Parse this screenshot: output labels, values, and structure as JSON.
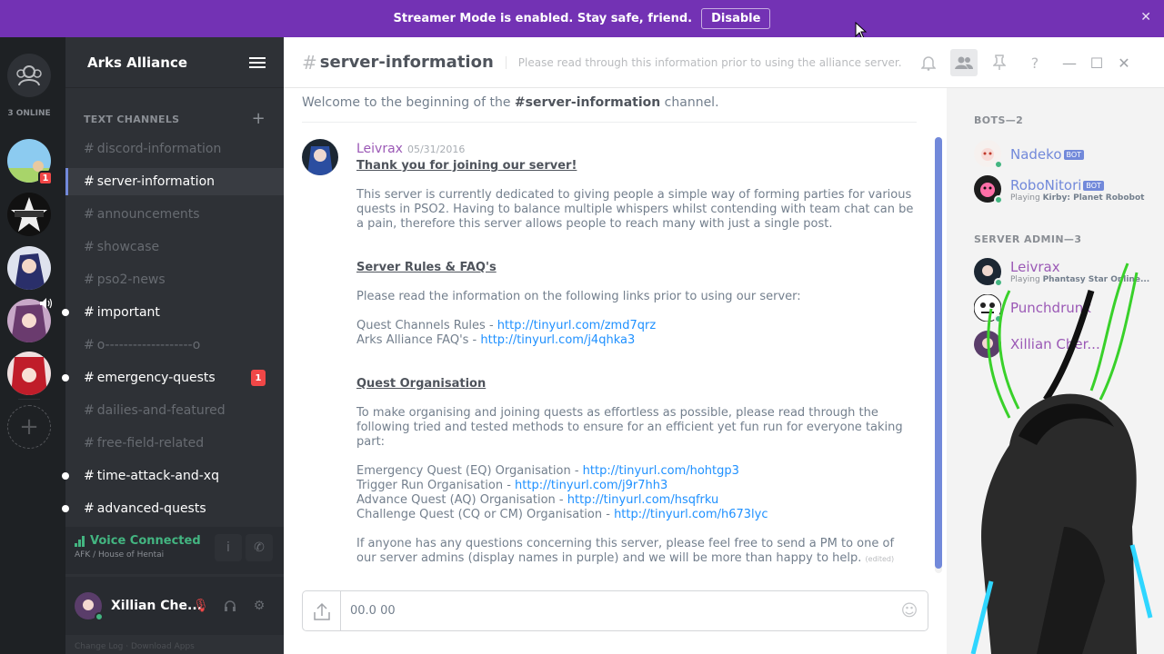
{
  "banner": {
    "text": "Streamer Mode is enabled. Stay safe, friend.",
    "button": "Disable",
    "close_glyph": "✕"
  },
  "guilds": {
    "online_text": "3 ONLINE",
    "badges": [
      "1"
    ]
  },
  "server": {
    "name": "Arks Alliance",
    "category": "TEXT CHANNELS",
    "channels": [
      {
        "name": "discord-information",
        "state": "read"
      },
      {
        "name": "server-information",
        "state": "active"
      },
      {
        "name": "announcements",
        "state": "read"
      },
      {
        "name": "showcase",
        "state": "read"
      },
      {
        "name": "pso2-news",
        "state": "read"
      },
      {
        "name": "important",
        "state": "unread"
      },
      {
        "name": "o-------------------o",
        "state": "read"
      },
      {
        "name": "emergency-quests",
        "state": "unread",
        "mentions": "1"
      },
      {
        "name": "dailies-and-featured",
        "state": "read"
      },
      {
        "name": "free-field-related",
        "state": "read"
      },
      {
        "name": "time-attack-and-xq",
        "state": "unread"
      },
      {
        "name": "advanced-quests",
        "state": "unread"
      }
    ]
  },
  "voice": {
    "status": "Voice Connected",
    "channel": "AFK / House of Hentai"
  },
  "user": {
    "name": "Xillian Che..."
  },
  "footer": {
    "links": "Change Log · Download Apps"
  },
  "chat": {
    "channel_name": "server-information",
    "topic": "Please read through this information prior to using the alliance server.",
    "welcome_prefix": "Welcome to the beginning of the ",
    "welcome_channel": "#server-information",
    "welcome_suffix": " channel.",
    "message": {
      "author": "Leivrax",
      "timestamp": "05/31/2016",
      "heading1": "Thank you for joining our server!",
      "para1": "This server is currently dedicated to giving people a simple way of forming parties for various quests in PSO2.  Having to balance multiple whispers whilst contending with team chat can be a pain, therefore this server allows people to reach many with just a single post.",
      "heading2": "Server Rules & FAQ's",
      "para2": "Please read the information on the following links prior to using our server:",
      "links1": [
        {
          "label": "Quest Channels Rules - ",
          "url": "http://tinyurl.com/zmd7qrz"
        },
        {
          "label": "Arks Alliance FAQ's - ",
          "url": "http://tinyurl.com/j4qhka3"
        }
      ],
      "heading3": "Quest Organisation",
      "para3": "To make organising and joining quests as effortless as possible, please read through the following tried and tested methods to ensure for an efficient yet fun run for everyone taking part:",
      "links2": [
        {
          "label": "Emergency Quest (EQ) Organisation - ",
          "url": "http://tinyurl.com/hohtgp3"
        },
        {
          "label": "Trigger Run Organisation - ",
          "url": "http://tinyurl.com/j9r7hh3"
        },
        {
          "label": "Advance Quest (AQ) Organisation - ",
          "url": "http://tinyurl.com/hsqfrku"
        },
        {
          "label": "Challenge Quest (CQ or CM) Organisation - ",
          "url": "http://tinyurl.com/h673lyc"
        }
      ],
      "para4": "If anyone has any questions concerning this server, please feel free to send a PM to one of our server admins (display names in purple) and we will be more than happy to help.",
      "edited": "(edited)"
    },
    "composer_value": "00.0 00"
  },
  "members": {
    "bots_header": "BOTS—2",
    "admin_header": "SERVER ADMIN—3",
    "bots": [
      {
        "name": "Nadeko",
        "tag": "BOT",
        "playing": ""
      },
      {
        "name": "RoboNitori",
        "tag": "BOT",
        "playing_prefix": "Playing ",
        "playing": "Kirby: Planet Robobot"
      }
    ],
    "admins": [
      {
        "name": "Leivrax",
        "playing_prefix": "Playing ",
        "playing": "Phantasy Star Online..."
      },
      {
        "name": "Punchdrunk",
        "playing": ""
      },
      {
        "name": "Xillian Cher...",
        "playing": ""
      }
    ]
  },
  "colors": {
    "banner": "#7332b4",
    "accent": "#7289da",
    "admin": "#9b59b6",
    "online": "#43b581",
    "link": "#1e90ff",
    "mention": "#f04747"
  }
}
